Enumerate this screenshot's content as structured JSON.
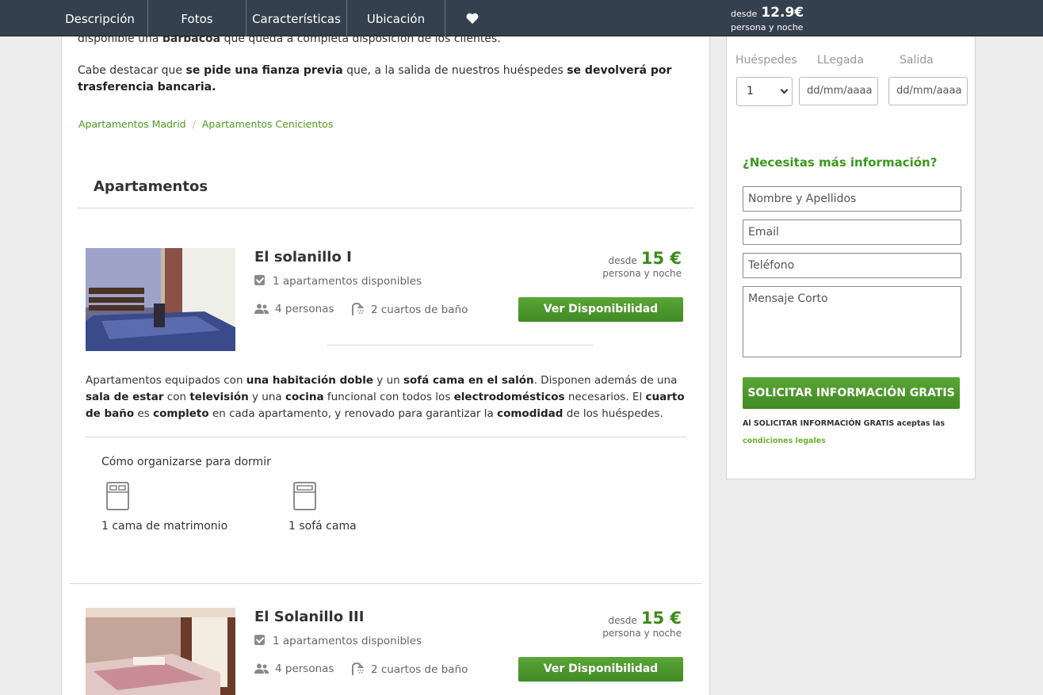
{
  "nav": {
    "items": [
      "Descripción",
      "Fotos",
      "Características",
      "Ubicación"
    ],
    "favorite_icon": "heart-icon",
    "price": {
      "desde": "desde",
      "amount": "12.9€",
      "per": "persona y noche"
    }
  },
  "content": {
    "para_top_cut": "disponible una barbacoa que queda a completa disposición de los clientes.",
    "para_fianza": {
      "p1": "Cabe destacar que ",
      "b1": "se pide una fianza previa",
      "p2": " que, a la salida de nuestros huéspedes ",
      "b2": "se devolverá por trasferencia bancaria."
    },
    "breadcrumbs": [
      "Apartamentos Madrid",
      "Apartamentos Cenicientos"
    ],
    "section_title": "Apartamentos"
  },
  "apartments": [
    {
      "name": "El solanillo I",
      "available": "1 apartamentos disponibles",
      "people": "4 personas",
      "baths": "2 cuartos de baño",
      "price_desde": "desde",
      "price": "15 €",
      "price_per": "persona y noche",
      "button": "Ver Disponibilidad",
      "description": {
        "t1": "Apartamentos equipados con ",
        "b1": "una habitación doble",
        "t2": " y un ",
        "b2": "sofá cama en el salón",
        "t3": ". Disponen además de una ",
        "b3": "sala de estar",
        "t4": " con ",
        "b4": "televisión",
        "t5": " y una ",
        "b5": "cocina",
        "t6": " funcional con todos los ",
        "b6": "electrodomésticos",
        "t7": " necesarios. El ",
        "b7": "cuarto de baño",
        "t8": " es ",
        "b8": "completo",
        "t9": " en cada apartamento, y renovado para garantizar la ",
        "b9": "comodidad",
        "t10": " de los huéspedes."
      },
      "sleep_title": "Cómo organizarse para dormir",
      "beds": [
        "1 cama de matrimonio",
        "1 sofá cama"
      ]
    },
    {
      "name": "El Solanillo III",
      "available": "1 apartamentos disponibles",
      "people": "4 personas",
      "baths": "2 cuartos de baño",
      "price_desde": "desde",
      "price": "15 €",
      "price_per": "persona y noche",
      "button": "Ver Disponibilidad"
    }
  ],
  "sidebar": {
    "labels": {
      "guests": "Huéspedes",
      "arrival": "LLegada",
      "departure": "Salida"
    },
    "guests_value": "1",
    "date_placeholder": "dd/mm/aaaa",
    "info_title": "¿Necesitas más información?",
    "name_placeholder": "Nombre y Apellidos",
    "email_placeholder": "Email",
    "phone_placeholder": "Teléfono",
    "message_placeholder": "Mensaje Corto",
    "submit": "SOLICITAR INFORMACIÓN GRATIS",
    "legal_text": "Al SOLICITAR INFORMACIÓN GRATIS aceptas las ",
    "legal_link": "condiciones legales"
  },
  "colors": {
    "nav_bg": "#34404d",
    "accent_green": "#3d8b1c",
    "button_green": "#4e9a2b"
  }
}
